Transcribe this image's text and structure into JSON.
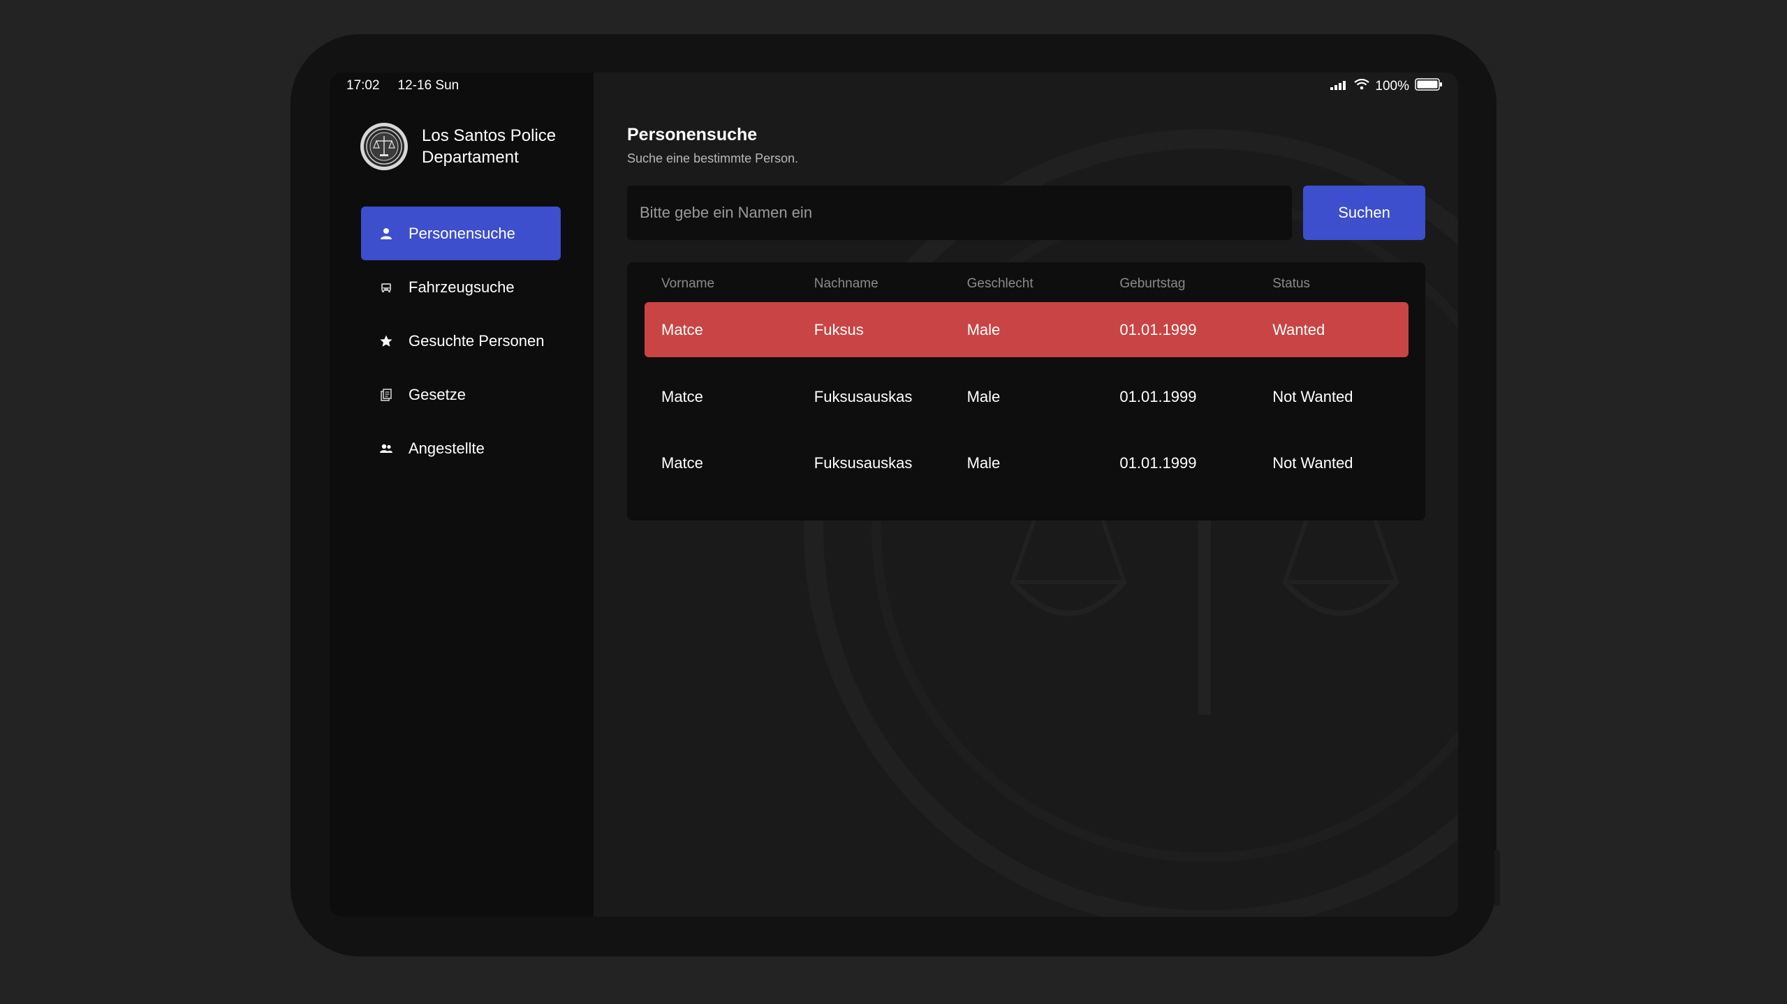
{
  "status_bar": {
    "time": "17:02",
    "date": "12-16 Sun",
    "battery": "100%"
  },
  "sidebar": {
    "org_name": "Los Santos Police Departament",
    "items": [
      {
        "label": "Personensuche",
        "icon": "person-icon",
        "active": true
      },
      {
        "label": "Fahrzeugsuche",
        "icon": "car-icon",
        "active": false
      },
      {
        "label": "Gesuchte Personen",
        "icon": "star-icon",
        "active": false
      },
      {
        "label": "Gesetze",
        "icon": "document-icon",
        "active": false
      },
      {
        "label": "Angestellte",
        "icon": "people-icon",
        "active": false
      }
    ]
  },
  "main": {
    "title": "Personensuche",
    "subtitle": "Suche eine bestimmte Person.",
    "search": {
      "placeholder": "Bitte gebe ein Namen ein",
      "value": "",
      "button_label": "Suchen"
    },
    "table": {
      "columns": [
        "Vorname",
        "Nachname",
        "Geschlecht",
        "Geburtstag",
        "Status"
      ],
      "rows": [
        {
          "vorname": "Matce",
          "nachname": "Fuksus",
          "geschlecht": "Male",
          "geburtstag": "01.01.1999",
          "status": "Wanted"
        },
        {
          "vorname": "Matce",
          "nachname": "Fuksusauskas",
          "geschlecht": "Male",
          "geburtstag": "01.01.1999",
          "status": "Not Wanted"
        },
        {
          "vorname": "Matce",
          "nachname": "Fuksusauskas",
          "geschlecht": "Male",
          "geburtstag": "01.01.1999",
          "status": "Not Wanted"
        }
      ]
    }
  },
  "colors": {
    "accent": "#3d4fcc",
    "wanted": "#c94444",
    "background": "#232323",
    "sidebar": "#0d0d0d",
    "main": "#1a1a1a"
  }
}
